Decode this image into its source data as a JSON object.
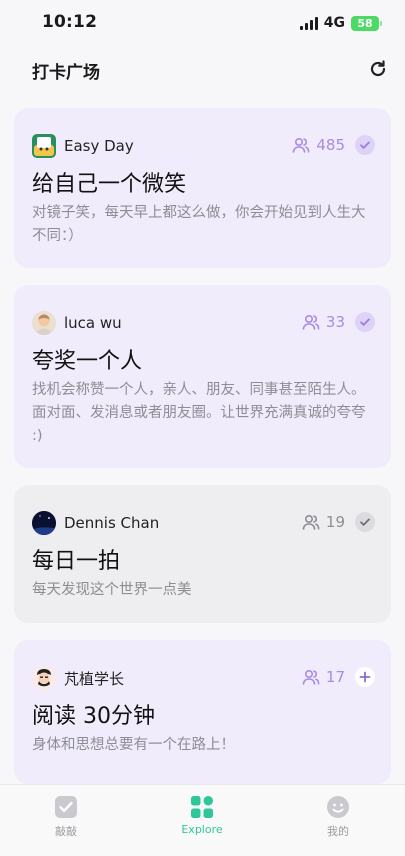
{
  "status_bar": {
    "time": "10:12",
    "network": "4G",
    "battery": "58"
  },
  "header": {
    "title": "打卡广场",
    "refresh_icon": "refresh-icon"
  },
  "colors": {
    "card_purple": "#f1ecfb",
    "card_gray": "#eeeef0",
    "accent_purple": "#a98be3",
    "accent_green": "#2fc79a",
    "muted_gray": "#8d8d94"
  },
  "cards": [
    {
      "author": "Easy Day",
      "count": "485",
      "status": "joined",
      "title": "给自己一个微笑",
      "desc": "对镜子笑，每天早上都这么做，你会开始见到人生大不同：）"
    },
    {
      "author": "luca wu",
      "count": "33",
      "status": "joined",
      "title": "夸奖一个人",
      "desc": "找机会称赞一个人，亲人、朋友、同事甚至陌生人。面对面、发消息或者朋友圈。让世界充满真诚的夸夸 :)"
    },
    {
      "author": "Dennis Chan",
      "count": "19",
      "status": "joined",
      "title": "每日一拍",
      "desc": "每天发现这个世界一点美"
    },
    {
      "author": "芃植学长",
      "count": "17",
      "status": "add",
      "title": "阅读 30分钟",
      "desc": "身体和思想总要有一个在路上！"
    }
  ],
  "tabbar": {
    "tabs": [
      {
        "label": "敲敲",
        "icon": "check-box-icon",
        "active": false
      },
      {
        "label": "Explore",
        "icon": "grid-icon",
        "active": true
      },
      {
        "label": "我的",
        "icon": "smiley-icon",
        "active": false
      }
    ]
  }
}
